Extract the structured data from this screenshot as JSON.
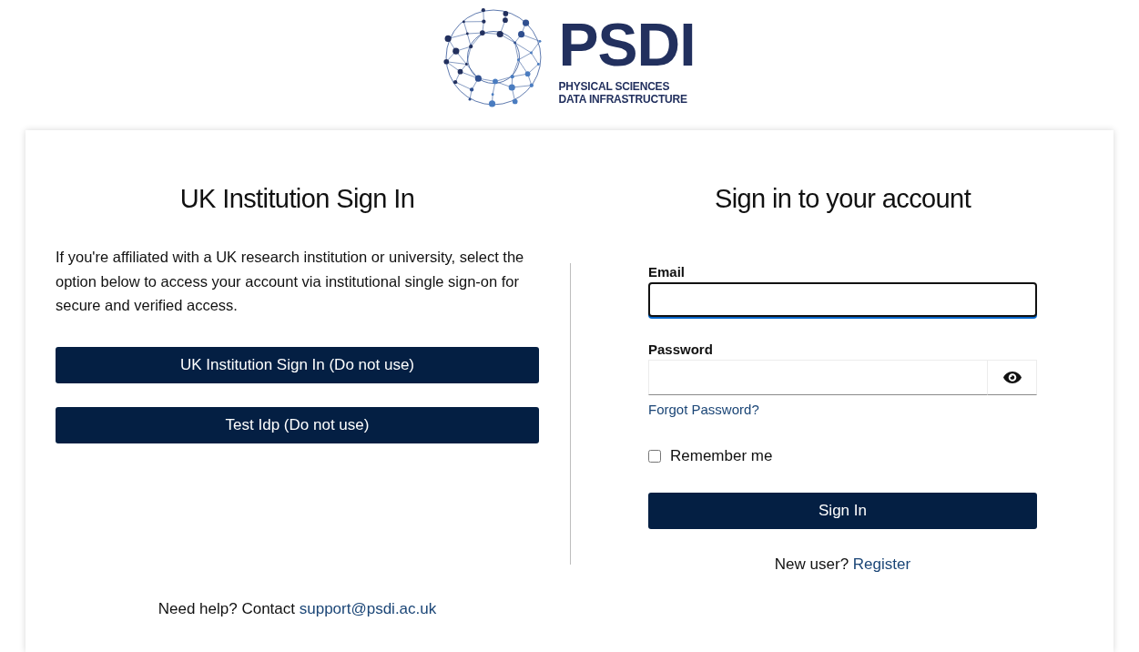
{
  "logo": {
    "wordmark": "PSDI",
    "tagline_lines": [
      "PHYSICAL SCIENCES",
      "DATA INFRASTRUCTURE"
    ]
  },
  "institution_panel": {
    "title": "UK Institution Sign In",
    "description": "If you're affiliated with a UK research institution or university, select the option below to access your account via institutional single sign-on for secure and verified access.",
    "buttons": [
      "UK Institution Sign In (Do not use)",
      "Test Idp (Do not use)"
    ]
  },
  "account_panel": {
    "title": "Sign in to your account",
    "fields": [
      {
        "kind": "email",
        "label": "Email",
        "focused": true
      },
      {
        "kind": "password",
        "label": "Password",
        "focused": false
      }
    ],
    "forgot_link": "Forgot Password?",
    "remember_me": {
      "label": "Remember me",
      "checked": false
    },
    "submit": "Sign In",
    "register": {
      "prompt": "New user?",
      "link": "Register"
    }
  },
  "help": {
    "prompt": "Need help? Contact",
    "link": "support@psdi.ac.uk"
  }
}
